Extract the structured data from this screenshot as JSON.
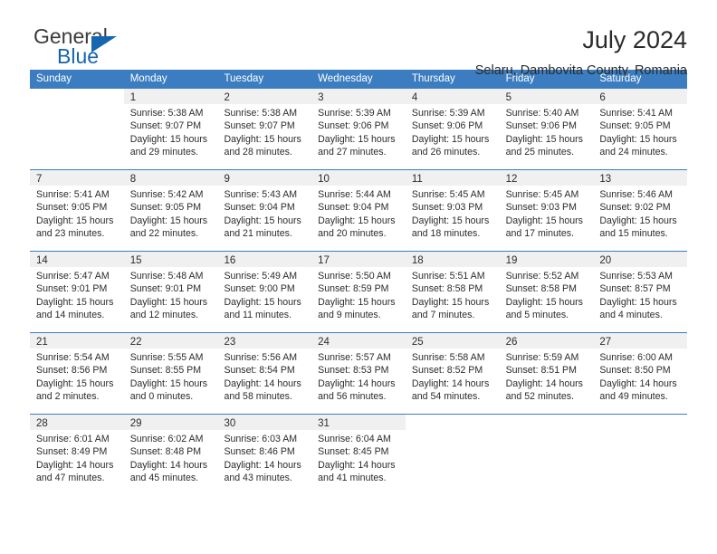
{
  "logo": {
    "word_top": "General",
    "word_bottom": "Blue",
    "accent_color": "#1565b0"
  },
  "header": {
    "title": "July 2024",
    "subtitle": "Selaru, Dambovita County, Romania"
  },
  "calendar": {
    "header_color": "#3b7dc0",
    "weekdays": [
      "Sunday",
      "Monday",
      "Tuesday",
      "Wednesday",
      "Thursday",
      "Friday",
      "Saturday"
    ],
    "labels": {
      "sunrise": "Sunrise:",
      "sunset": "Sunset:",
      "daylight": "Daylight:"
    },
    "weeks": [
      [
        {
          "day": "",
          "sunrise": "",
          "sunset": "",
          "daylight_line1": "",
          "daylight_line2": ""
        },
        {
          "day": "1",
          "sunrise": "Sunrise: 5:38 AM",
          "sunset": "Sunset: 9:07 PM",
          "daylight_line1": "Daylight: 15 hours",
          "daylight_line2": "and 29 minutes."
        },
        {
          "day": "2",
          "sunrise": "Sunrise: 5:38 AM",
          "sunset": "Sunset: 9:07 PM",
          "daylight_line1": "Daylight: 15 hours",
          "daylight_line2": "and 28 minutes."
        },
        {
          "day": "3",
          "sunrise": "Sunrise: 5:39 AM",
          "sunset": "Sunset: 9:06 PM",
          "daylight_line1": "Daylight: 15 hours",
          "daylight_line2": "and 27 minutes."
        },
        {
          "day": "4",
          "sunrise": "Sunrise: 5:39 AM",
          "sunset": "Sunset: 9:06 PM",
          "daylight_line1": "Daylight: 15 hours",
          "daylight_line2": "and 26 minutes."
        },
        {
          "day": "5",
          "sunrise": "Sunrise: 5:40 AM",
          "sunset": "Sunset: 9:06 PM",
          "daylight_line1": "Daylight: 15 hours",
          "daylight_line2": "and 25 minutes."
        },
        {
          "day": "6",
          "sunrise": "Sunrise: 5:41 AM",
          "sunset": "Sunset: 9:05 PM",
          "daylight_line1": "Daylight: 15 hours",
          "daylight_line2": "and 24 minutes."
        }
      ],
      [
        {
          "day": "7",
          "sunrise": "Sunrise: 5:41 AM",
          "sunset": "Sunset: 9:05 PM",
          "daylight_line1": "Daylight: 15 hours",
          "daylight_line2": "and 23 minutes."
        },
        {
          "day": "8",
          "sunrise": "Sunrise: 5:42 AM",
          "sunset": "Sunset: 9:05 PM",
          "daylight_line1": "Daylight: 15 hours",
          "daylight_line2": "and 22 minutes."
        },
        {
          "day": "9",
          "sunrise": "Sunrise: 5:43 AM",
          "sunset": "Sunset: 9:04 PM",
          "daylight_line1": "Daylight: 15 hours",
          "daylight_line2": "and 21 minutes."
        },
        {
          "day": "10",
          "sunrise": "Sunrise: 5:44 AM",
          "sunset": "Sunset: 9:04 PM",
          "daylight_line1": "Daylight: 15 hours",
          "daylight_line2": "and 20 minutes."
        },
        {
          "day": "11",
          "sunrise": "Sunrise: 5:45 AM",
          "sunset": "Sunset: 9:03 PM",
          "daylight_line1": "Daylight: 15 hours",
          "daylight_line2": "and 18 minutes."
        },
        {
          "day": "12",
          "sunrise": "Sunrise: 5:45 AM",
          "sunset": "Sunset: 9:03 PM",
          "daylight_line1": "Daylight: 15 hours",
          "daylight_line2": "and 17 minutes."
        },
        {
          "day": "13",
          "sunrise": "Sunrise: 5:46 AM",
          "sunset": "Sunset: 9:02 PM",
          "daylight_line1": "Daylight: 15 hours",
          "daylight_line2": "and 15 minutes."
        }
      ],
      [
        {
          "day": "14",
          "sunrise": "Sunrise: 5:47 AM",
          "sunset": "Sunset: 9:01 PM",
          "daylight_line1": "Daylight: 15 hours",
          "daylight_line2": "and 14 minutes."
        },
        {
          "day": "15",
          "sunrise": "Sunrise: 5:48 AM",
          "sunset": "Sunset: 9:01 PM",
          "daylight_line1": "Daylight: 15 hours",
          "daylight_line2": "and 12 minutes."
        },
        {
          "day": "16",
          "sunrise": "Sunrise: 5:49 AM",
          "sunset": "Sunset: 9:00 PM",
          "daylight_line1": "Daylight: 15 hours",
          "daylight_line2": "and 11 minutes."
        },
        {
          "day": "17",
          "sunrise": "Sunrise: 5:50 AM",
          "sunset": "Sunset: 8:59 PM",
          "daylight_line1": "Daylight: 15 hours",
          "daylight_line2": "and 9 minutes."
        },
        {
          "day": "18",
          "sunrise": "Sunrise: 5:51 AM",
          "sunset": "Sunset: 8:58 PM",
          "daylight_line1": "Daylight: 15 hours",
          "daylight_line2": "and 7 minutes."
        },
        {
          "day": "19",
          "sunrise": "Sunrise: 5:52 AM",
          "sunset": "Sunset: 8:58 PM",
          "daylight_line1": "Daylight: 15 hours",
          "daylight_line2": "and 5 minutes."
        },
        {
          "day": "20",
          "sunrise": "Sunrise: 5:53 AM",
          "sunset": "Sunset: 8:57 PM",
          "daylight_line1": "Daylight: 15 hours",
          "daylight_line2": "and 4 minutes."
        }
      ],
      [
        {
          "day": "21",
          "sunrise": "Sunrise: 5:54 AM",
          "sunset": "Sunset: 8:56 PM",
          "daylight_line1": "Daylight: 15 hours",
          "daylight_line2": "and 2 minutes."
        },
        {
          "day": "22",
          "sunrise": "Sunrise: 5:55 AM",
          "sunset": "Sunset: 8:55 PM",
          "daylight_line1": "Daylight: 15 hours",
          "daylight_line2": "and 0 minutes."
        },
        {
          "day": "23",
          "sunrise": "Sunrise: 5:56 AM",
          "sunset": "Sunset: 8:54 PM",
          "daylight_line1": "Daylight: 14 hours",
          "daylight_line2": "and 58 minutes."
        },
        {
          "day": "24",
          "sunrise": "Sunrise: 5:57 AM",
          "sunset": "Sunset: 8:53 PM",
          "daylight_line1": "Daylight: 14 hours",
          "daylight_line2": "and 56 minutes."
        },
        {
          "day": "25",
          "sunrise": "Sunrise: 5:58 AM",
          "sunset": "Sunset: 8:52 PM",
          "daylight_line1": "Daylight: 14 hours",
          "daylight_line2": "and 54 minutes."
        },
        {
          "day": "26",
          "sunrise": "Sunrise: 5:59 AM",
          "sunset": "Sunset: 8:51 PM",
          "daylight_line1": "Daylight: 14 hours",
          "daylight_line2": "and 52 minutes."
        },
        {
          "day": "27",
          "sunrise": "Sunrise: 6:00 AM",
          "sunset": "Sunset: 8:50 PM",
          "daylight_line1": "Daylight: 14 hours",
          "daylight_line2": "and 49 minutes."
        }
      ],
      [
        {
          "day": "28",
          "sunrise": "Sunrise: 6:01 AM",
          "sunset": "Sunset: 8:49 PM",
          "daylight_line1": "Daylight: 14 hours",
          "daylight_line2": "and 47 minutes."
        },
        {
          "day": "29",
          "sunrise": "Sunrise: 6:02 AM",
          "sunset": "Sunset: 8:48 PM",
          "daylight_line1": "Daylight: 14 hours",
          "daylight_line2": "and 45 minutes."
        },
        {
          "day": "30",
          "sunrise": "Sunrise: 6:03 AM",
          "sunset": "Sunset: 8:46 PM",
          "daylight_line1": "Daylight: 14 hours",
          "daylight_line2": "and 43 minutes."
        },
        {
          "day": "31",
          "sunrise": "Sunrise: 6:04 AM",
          "sunset": "Sunset: 8:45 PM",
          "daylight_line1": "Daylight: 14 hours",
          "daylight_line2": "and 41 minutes."
        },
        {
          "day": "",
          "sunrise": "",
          "sunset": "",
          "daylight_line1": "",
          "daylight_line2": ""
        },
        {
          "day": "",
          "sunrise": "",
          "sunset": "",
          "daylight_line1": "",
          "daylight_line2": ""
        },
        {
          "day": "",
          "sunrise": "",
          "sunset": "",
          "daylight_line1": "",
          "daylight_line2": ""
        }
      ]
    ]
  }
}
